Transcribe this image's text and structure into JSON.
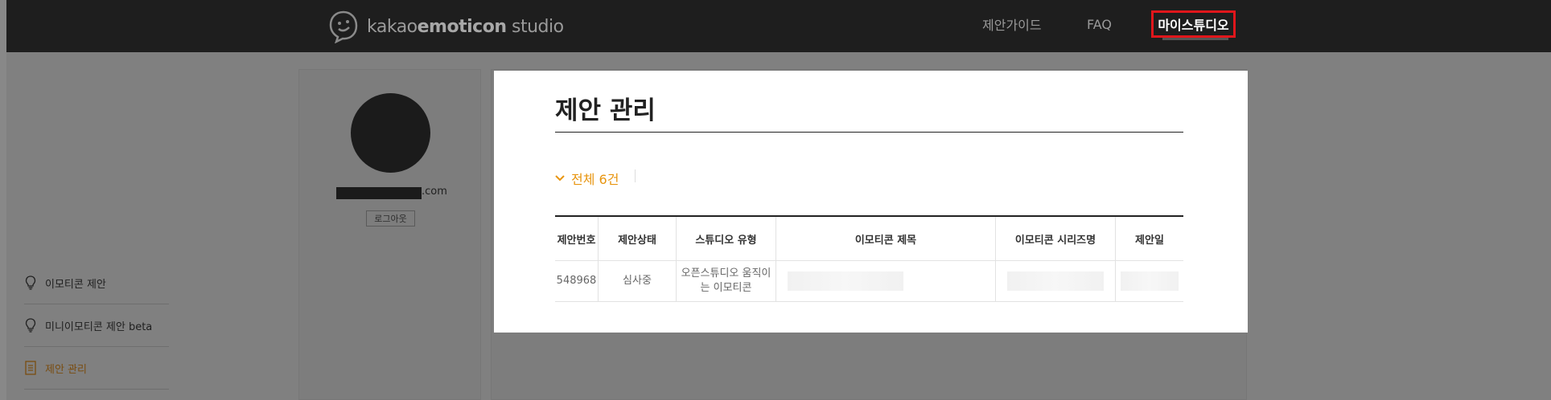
{
  "header": {
    "logo_prefix": "kakao",
    "logo_bold": "emoticon",
    "logo_suffix": " studio",
    "nav": [
      "제안가이드",
      "FAQ"
    ],
    "my_studio": "마이스튜디오"
  },
  "sidebar": {
    "email_suffix": ".com",
    "logout": "로그아웃",
    "menu": [
      {
        "label": "이모티콘 제안",
        "icon": "bulb-icon"
      },
      {
        "label": "미니이모티콘 제안 beta",
        "icon": "bulb-icon"
      },
      {
        "label": "제안 관리",
        "icon": "document-icon"
      }
    ]
  },
  "main": {
    "title": "제안 관리",
    "total": "전체 6건",
    "columns": [
      "제안번호",
      "제안상태",
      "스튜디오 유형",
      "이모티콘 제목",
      "이모티콘 시리즈명",
      "제안일"
    ],
    "rows": [
      {
        "id": "548968",
        "status": "심사중",
        "type": "오픈스튜디오 움직이는 이모티콘"
      }
    ]
  },
  "colors": {
    "accent": "#e8950f",
    "highlight": "#e0161b",
    "topbar": "#1e1e1e"
  }
}
